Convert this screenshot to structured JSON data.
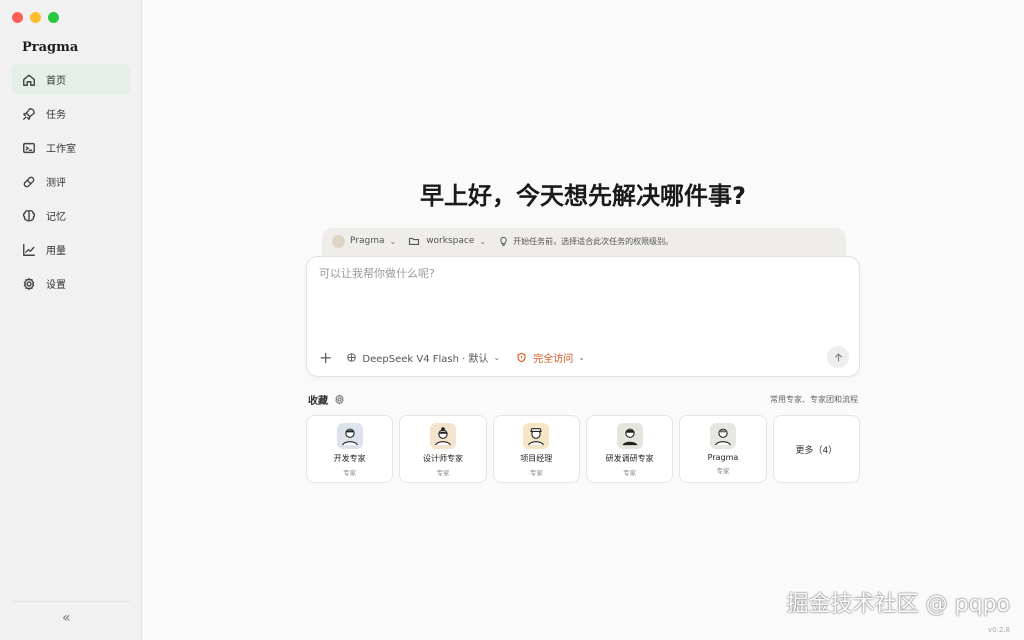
{
  "sidebar": {
    "brand": "Pragma",
    "items": [
      {
        "label": "首页",
        "icon": "home-icon",
        "active": true
      },
      {
        "label": "任务",
        "icon": "rocket-icon"
      },
      {
        "label": "工作室",
        "icon": "terminal-icon"
      },
      {
        "label": "测评",
        "icon": "pill-icon"
      },
      {
        "label": "记忆",
        "icon": "brain-icon"
      },
      {
        "label": "用量",
        "icon": "trend-icon"
      },
      {
        "label": "设置",
        "icon": "gear-icon"
      }
    ],
    "collapse_label": "«"
  },
  "main": {
    "greeting": "早上好，今天想先解决哪件事?",
    "context": {
      "agent": "Pragma",
      "folder": "workspace",
      "hint": "开始任务前，选择适合此次任务的权限级别。"
    },
    "composer": {
      "placeholder": "可以让我帮你做什么呢?",
      "value": "",
      "plus": "+",
      "model": "DeepSeek V4 Flash · 默认",
      "access": "完全访问"
    },
    "favorites": {
      "title": "收藏",
      "right_label": "常用专家、专家团和流程",
      "cards": [
        {
          "name": "开发专家",
          "sub": "专家",
          "bg": "#dde3ec"
        },
        {
          "name": "设计师专家",
          "sub": "专家",
          "bg": "#f3e2cc"
        },
        {
          "name": "项目经理",
          "sub": "专家",
          "bg": "#f5e6c6"
        },
        {
          "name": "研发调研专家",
          "sub": "专家",
          "bg": "#e3e6dc"
        },
        {
          "name": "Pragma",
          "sub": "专家",
          "bg": "#e6e6e2"
        }
      ],
      "more_label": "更多（4）"
    }
  },
  "watermark": "掘金技术社区 @ pqpo",
  "version": "v0.2.8",
  "colors": {
    "accent": "#d9541f",
    "active_nav": "#e6eee8"
  }
}
